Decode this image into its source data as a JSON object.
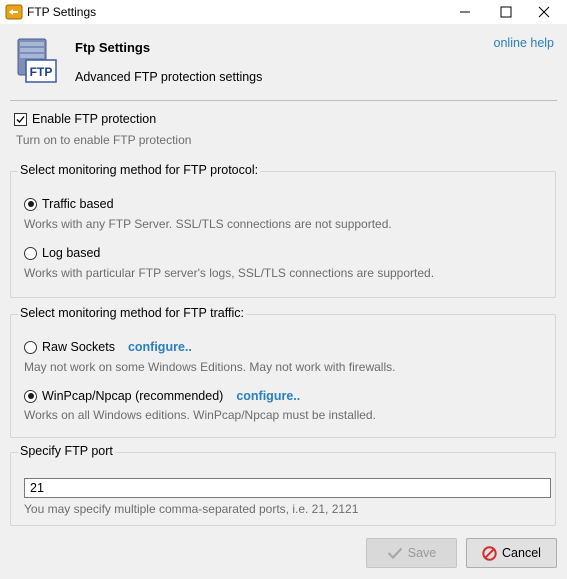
{
  "window": {
    "title": "FTP Settings",
    "icons": {
      "app": "ftp-settings-icon",
      "minimize": "minimize-icon",
      "maximize": "maximize-icon",
      "close": "close-icon"
    }
  },
  "header": {
    "icon_label": "FTP",
    "title": "Ftp Settings",
    "subtitle": "Advanced FTP protection settings",
    "help_link": "online help"
  },
  "enable": {
    "label": "Enable FTP protection",
    "checked": true,
    "hint": "Turn on to enable FTP protection"
  },
  "protocol_group": {
    "title": "Select monitoring method for FTP protocol:",
    "options": [
      {
        "label": "Traffic based",
        "selected": true,
        "hint": "Works with any FTP Server. SSL/TLS connections are not supported."
      },
      {
        "label": "Log based",
        "selected": false,
        "hint": "Works with particular FTP server's logs, SSL/TLS connections are supported."
      }
    ]
  },
  "traffic_group": {
    "title": "Select monitoring method for FTP traffic:",
    "options": [
      {
        "label": "Raw Sockets",
        "selected": false,
        "configure": "configure..",
        "hint": "May not work on some Windows Editions. May not work with firewalls."
      },
      {
        "label": "WinPcap/Npcap (recommended)",
        "selected": true,
        "configure": "configure..",
        "hint": "Works on all Windows editions. WinPcap/Npcap must be installed."
      }
    ]
  },
  "port_group": {
    "title": "Specify FTP port",
    "value": "21",
    "hint": "You may specify multiple comma-separated ports, i.e. 21, 2121"
  },
  "buttons": {
    "save": "Save",
    "save_enabled": false,
    "cancel": "Cancel"
  },
  "colors": {
    "link": "#2a7fc1",
    "hint": "#6d6d6d",
    "cancel_icon": "#d32f2f",
    "check_icon": "#a8a8a8"
  }
}
